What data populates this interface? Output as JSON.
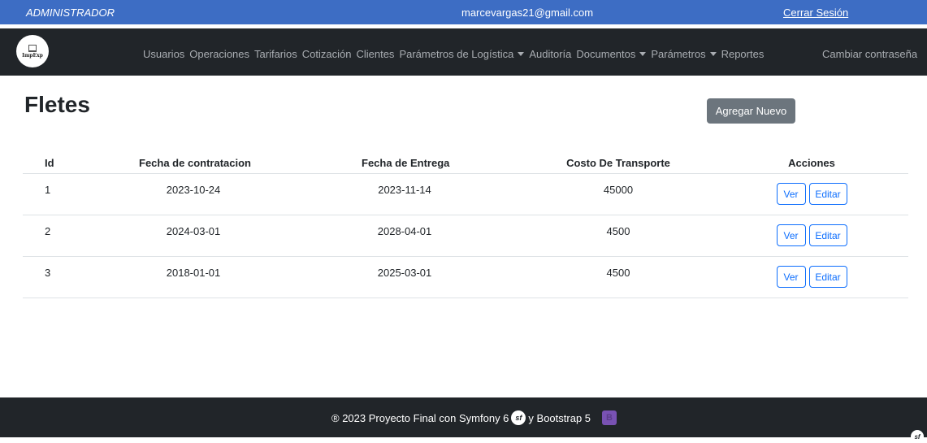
{
  "topbar": {
    "role": "ADMINISTRADOR",
    "email": "marcevargas21@gmail.com",
    "logout": "Cerrar Sesión"
  },
  "navbar": {
    "logo_text": "ImpExp",
    "logo_icon": "building-icon",
    "links": [
      {
        "label": "Usuarios",
        "dropdown": false
      },
      {
        "label": "Operaciones",
        "dropdown": false
      },
      {
        "label": "Tarifarios",
        "dropdown": false
      },
      {
        "label": "Cotización",
        "dropdown": false
      },
      {
        "label": "Clientes",
        "dropdown": false
      },
      {
        "label": "Parámetros de Logística",
        "dropdown": true
      },
      {
        "label": "Auditoría",
        "dropdown": false
      },
      {
        "label": "Documentos",
        "dropdown": true
      },
      {
        "label": "Parámetros",
        "dropdown": true
      },
      {
        "label": "Reportes",
        "dropdown": false
      }
    ],
    "right_link": "Cambiar contraseña"
  },
  "page": {
    "title": "Fletes",
    "add_button": "Agregar Nuevo"
  },
  "table": {
    "headers": {
      "id": "Id",
      "fecha_contratacion": "Fecha de contratacion",
      "fecha_entrega": "Fecha de Entrega",
      "costo": "Costo De Transporte",
      "acciones": "Acciones"
    },
    "rows": [
      {
        "id": "1",
        "fecha_contratacion": "2023-10-24",
        "fecha_entrega": "2023-11-14",
        "costo": "45000"
      },
      {
        "id": "2",
        "fecha_contratacion": "2024-03-01",
        "fecha_entrega": "2028-04-01",
        "costo": "4500"
      },
      {
        "id": "3",
        "fecha_contratacion": "2018-01-01",
        "fecha_entrega": "2025-03-01",
        "costo": "4500"
      }
    ],
    "view_label": "Ver",
    "edit_label": "Editar"
  },
  "footer": {
    "text_before": "® 2023 Proyecto Final con Symfony 6",
    "text_middle": "y Bootstrap 5",
    "symfony_icon": "sf",
    "bootstrap_icon": "B"
  },
  "colors": {
    "topbar": "#3d6dc4",
    "navbar": "#212529",
    "primary_outline": "#0d6efd",
    "secondary_button": "#6c757d"
  }
}
